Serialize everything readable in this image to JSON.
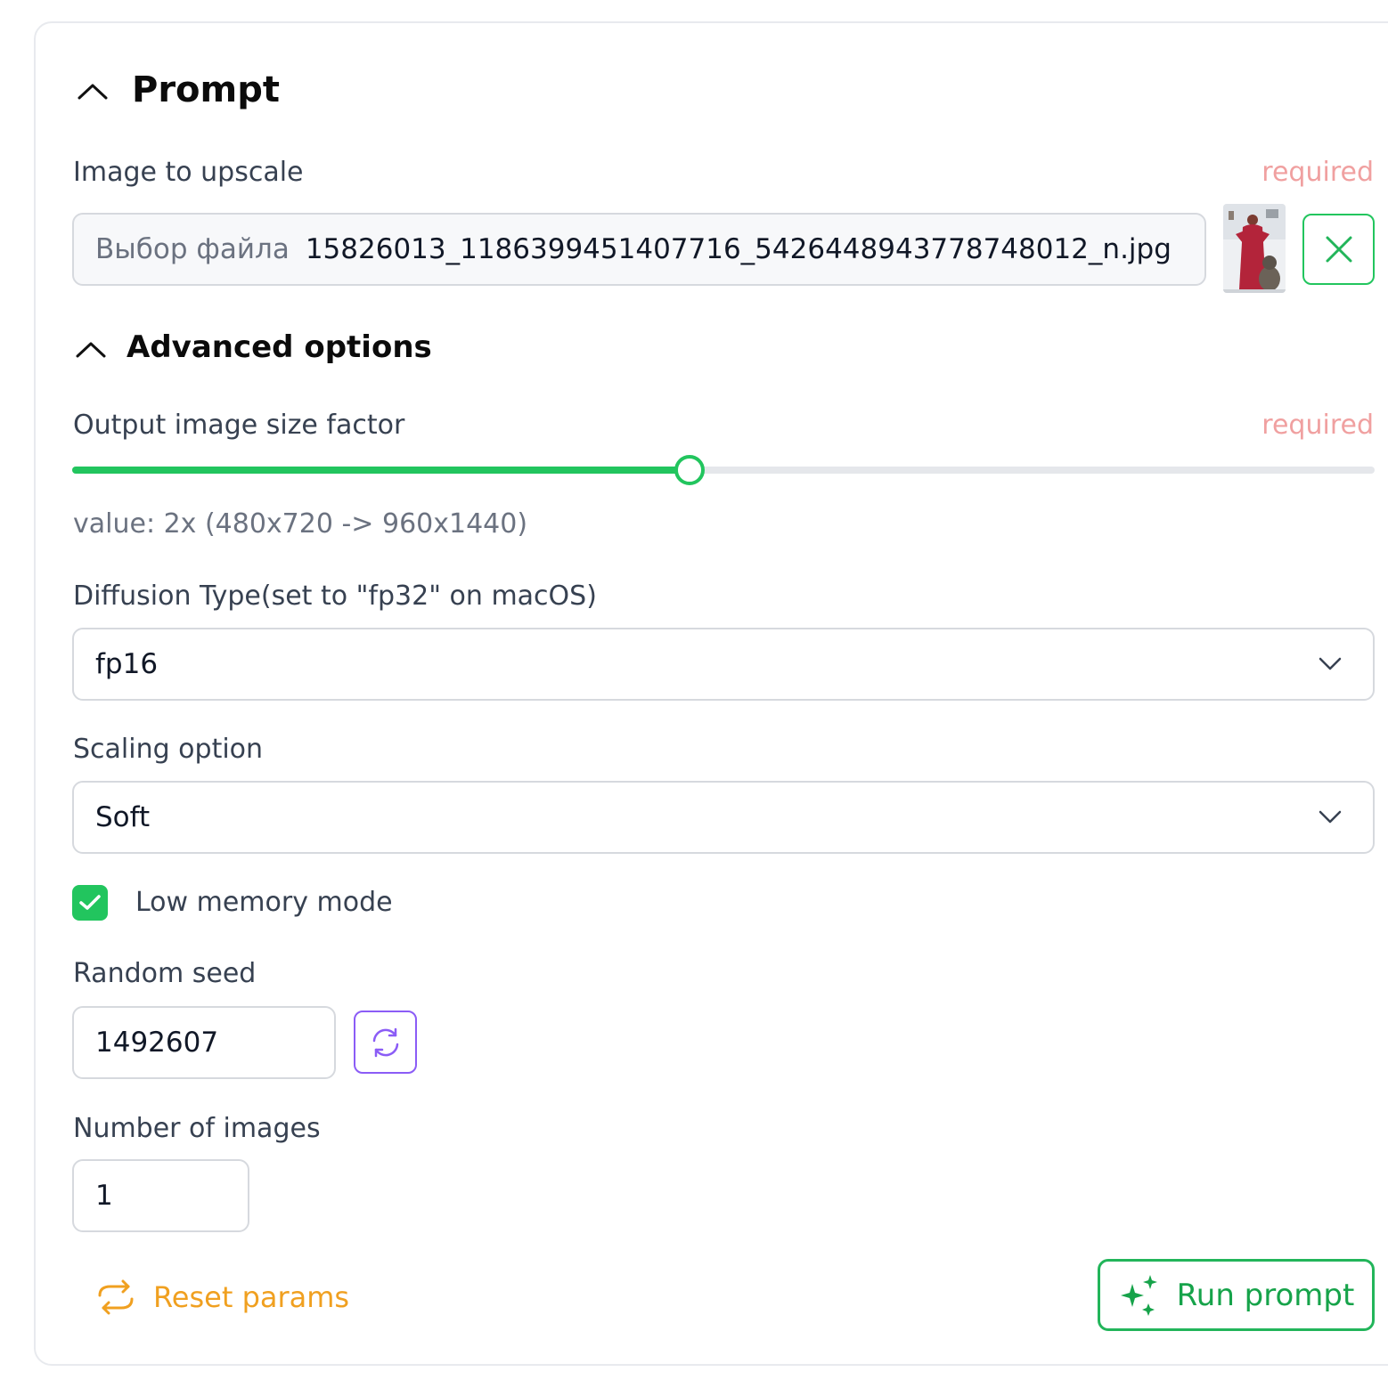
{
  "prompt_section": {
    "title": "Prompt",
    "image_field": {
      "label": "Image to upscale",
      "required": "required",
      "button": "Выбор файла",
      "filename": "15826013_1186399451407716_5426448943778748012_n.jpg"
    }
  },
  "advanced": {
    "title": "Advanced options",
    "size_factor": {
      "label": "Output image size factor",
      "required": "required",
      "slider_fraction": 0.474,
      "value_text": "value: 2x (480x720 -> 960x1440)"
    },
    "diffusion": {
      "label": "Diffusion Type(set to \"fp32\" on macOS)",
      "value": "fp16"
    },
    "scaling": {
      "label": "Scaling option",
      "value": "Soft"
    },
    "low_memory": {
      "label": "Low memory mode",
      "checked": true
    },
    "seed": {
      "label": "Random seed",
      "value": "1492607"
    },
    "num_images": {
      "label": "Number of images",
      "value": "1"
    }
  },
  "actions": {
    "reset": "Reset params",
    "run": "Run prompt"
  },
  "colors": {
    "accent_green": "#22c55e",
    "required_red": "#f0a0a0",
    "reset_orange": "#f0a020",
    "refresh_purple": "#8b5cf6"
  }
}
